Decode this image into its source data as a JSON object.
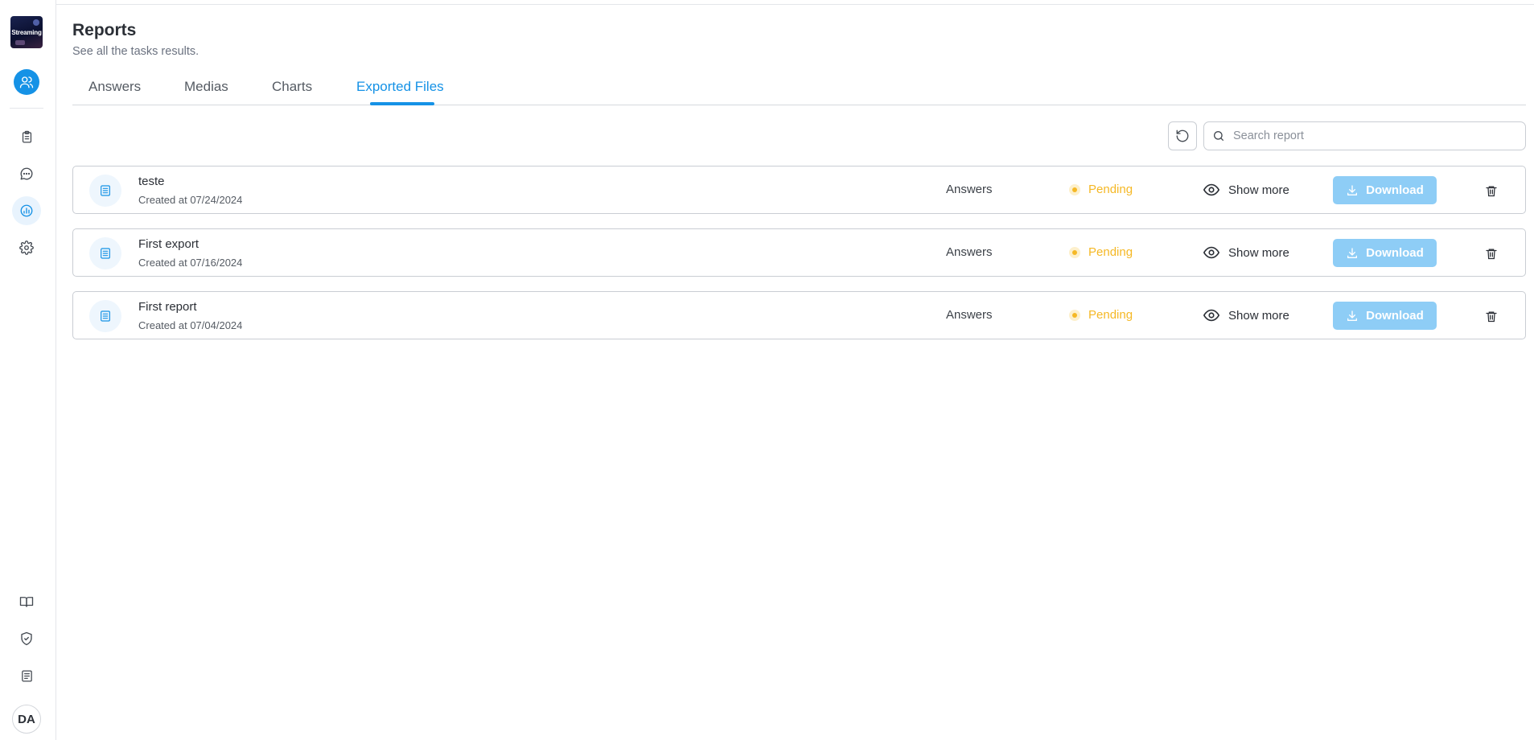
{
  "brand": {
    "logo_text": "Streaming"
  },
  "sidebar": {
    "top_items": [
      {
        "name": "users",
        "icon": "users-icon"
      },
      {
        "name": "tasks",
        "icon": "clipboard-icon"
      },
      {
        "name": "messages",
        "icon": "chat-icon"
      },
      {
        "name": "reports",
        "icon": "chart-icon",
        "active": true
      },
      {
        "name": "settings",
        "icon": "gear-icon"
      }
    ],
    "bottom_items": [
      {
        "name": "docs",
        "icon": "book-icon"
      },
      {
        "name": "security",
        "icon": "shield-check-icon"
      },
      {
        "name": "terms",
        "icon": "document-icon"
      }
    ],
    "avatar_initials": "DA"
  },
  "header": {
    "title": "Reports",
    "subtitle": "See all the tasks results."
  },
  "tabs": [
    {
      "label": "Answers"
    },
    {
      "label": "Medias"
    },
    {
      "label": "Charts"
    },
    {
      "label": "Exported Files",
      "active": true
    }
  ],
  "toolbar": {
    "search_placeholder": "Search report"
  },
  "row_labels": {
    "show_more": "Show more",
    "download": "Download"
  },
  "exports": [
    {
      "name": "teste",
      "created": "Created at 07/24/2024",
      "type": "Answers",
      "status": "Pending"
    },
    {
      "name": "First export",
      "created": "Created at 07/16/2024",
      "type": "Answers",
      "status": "Pending"
    },
    {
      "name": "First report",
      "created": "Created at 07/04/2024",
      "type": "Answers",
      "status": "Pending"
    }
  ],
  "colors": {
    "accent": "#1592e6",
    "pending": "#f5b825",
    "download_button": "#8ecdf6"
  }
}
